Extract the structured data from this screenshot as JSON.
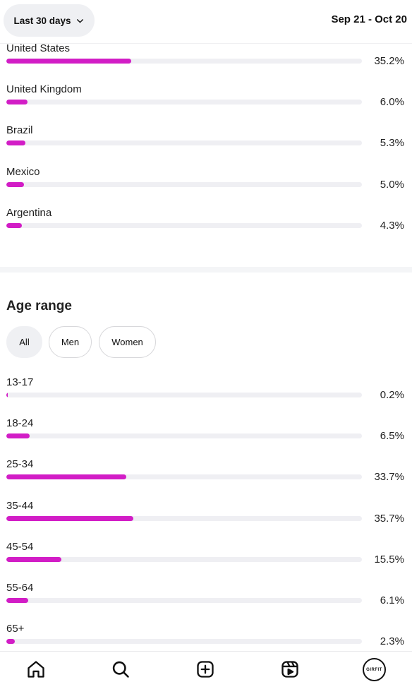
{
  "header": {
    "range_label": "Last 30 days",
    "date_range": "Sep 21 - Oct 20"
  },
  "countries": [
    {
      "label": "United States",
      "value": "35.2%",
      "pct": 35.2
    },
    {
      "label": "United Kingdom",
      "value": "6.0%",
      "pct": 6.0
    },
    {
      "label": "Brazil",
      "value": "5.3%",
      "pct": 5.3
    },
    {
      "label": "Mexico",
      "value": "5.0%",
      "pct": 5.0
    },
    {
      "label": "Argentina",
      "value": "4.3%",
      "pct": 4.3
    }
  ],
  "age_section": {
    "title": "Age range",
    "filters": [
      {
        "label": "All",
        "active": true
      },
      {
        "label": "Men",
        "active": false
      },
      {
        "label": "Women",
        "active": false
      }
    ],
    "rows": [
      {
        "label": "13-17",
        "value": "0.2%",
        "pct": 0.2
      },
      {
        "label": "18-24",
        "value": "6.5%",
        "pct": 6.5
      },
      {
        "label": "25-34",
        "value": "33.7%",
        "pct": 33.7
      },
      {
        "label": "35-44",
        "value": "35.7%",
        "pct": 35.7
      },
      {
        "label": "45-54",
        "value": "15.5%",
        "pct": 15.5
      },
      {
        "label": "55-64",
        "value": "6.1%",
        "pct": 6.1
      },
      {
        "label": "65+",
        "value": "2.3%",
        "pct": 2.3
      }
    ]
  },
  "bottom_nav": {
    "items": [
      "home-icon",
      "search-icon",
      "create-icon",
      "reels-icon",
      "profile-avatar"
    ],
    "avatar_text": "GIRFIT"
  },
  "colors": {
    "bar_fill": "#d21dc6",
    "bar_track": "#efeff3",
    "chip_active": "#eff0f3"
  }
}
